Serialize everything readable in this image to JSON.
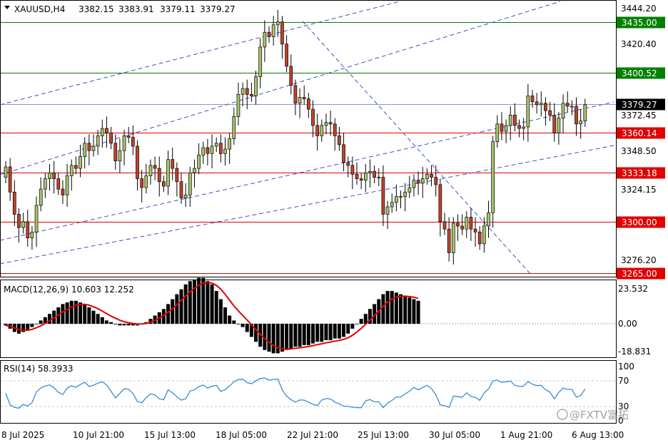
{
  "header": {
    "symbol": "XAUUSD,H4",
    "open": "3382.15",
    "high": "3383.91",
    "low": "3379.11",
    "close": "3379.27"
  },
  "price_axis": {
    "ticks": [
      "3444.20",
      "3420.40",
      "3372.45",
      "3348.50",
      "3324.15",
      "3276.20"
    ],
    "levels": [
      {
        "price": 3435.0,
        "label": "3435.00",
        "color": "#008000"
      },
      {
        "price": 3400.52,
        "label": "3400.52",
        "color": "#008000"
      },
      {
        "price": 3379.27,
        "label": "3379.27",
        "color": "#000000"
      },
      {
        "price": 3360.14,
        "label": "3360.14",
        "color": "#e00000"
      },
      {
        "price": 3333.18,
        "label": "3333.18",
        "color": "#e00000"
      },
      {
        "price": 3300.0,
        "label": "3300.00",
        "color": "#e00000"
      },
      {
        "price": 3265.0,
        "label": "3265.00",
        "color": "#e00000"
      }
    ]
  },
  "macd": {
    "label": "MACD(12,26,9) 10.603 12.252",
    "ticks": [
      "23.532",
      "0.00",
      "-18.831"
    ]
  },
  "rsi": {
    "label": "RSI(14) 58.3933",
    "ticks": [
      "100",
      "70",
      "30",
      "0"
    ]
  },
  "time_axis": {
    "labels": [
      "8 Jul 2025",
      "10 Jul 21:00",
      "15 Jul 13:00",
      "18 Jul 05:00",
      "22 Jul 21:00",
      "25 Jul 13:00",
      "30 Jul 05:00",
      "1 Aug 21:00",
      "6 Aug 13:00"
    ]
  },
  "watermark": {
    "text": "@FXTV富拓"
  },
  "colors": {
    "bull": "#a8c46a",
    "bear": "#c0432a",
    "support": "#e00000",
    "resistance": "#008000",
    "channel": "#2540c0",
    "signal": "#e00000",
    "rsi_line": "#3a8ad6"
  },
  "chart_data": {
    "type": "candlestick",
    "symbol": "XAUUSD",
    "timeframe": "H4",
    "close": [
      3337,
      3320,
      3305,
      3296,
      3300,
      3289,
      3293,
      3311,
      3322,
      3329,
      3333,
      3329,
      3322,
      3318,
      3331,
      3338,
      3336,
      3344,
      3353,
      3348,
      3351,
      3358,
      3363,
      3360,
      3353,
      3341,
      3348,
      3358,
      3357,
      3351,
      3329,
      3323,
      3331,
      3338,
      3336,
      3327,
      3324,
      3342,
      3336,
      3327,
      3316,
      3318,
      3333,
      3336,
      3345,
      3350,
      3346,
      3351,
      3353,
      3346,
      3349,
      3356,
      3371,
      3386,
      3390,
      3386,
      3385,
      3398,
      3418,
      3428,
      3425,
      3433,
      3435,
      3420,
      3405,
      3392,
      3380,
      3384,
      3383,
      3376,
      3365,
      3358,
      3365,
      3367,
      3366,
      3358,
      3352,
      3340,
      3338,
      3332,
      3329,
      3328,
      3333,
      3334,
      3330,
      3330,
      3305,
      3310,
      3313,
      3317,
      3317,
      3320,
      3323,
      3328,
      3326,
      3329,
      3332,
      3330,
      3325,
      3300,
      3295,
      3279,
      3299,
      3297,
      3295,
      3303,
      3295,
      3293,
      3285,
      3297,
      3306,
      3354,
      3366,
      3361,
      3365,
      3372,
      3365,
      3363,
      3364,
      3385,
      3381,
      3379,
      3380,
      3375,
      3372,
      3360,
      3370,
      3380,
      3378,
      3378,
      3366,
      3368,
      3379
    ],
    "macd_hist": [
      -1,
      -3,
      -5,
      -6,
      -5,
      -4,
      -2,
      0,
      2,
      4,
      6,
      8,
      10,
      12,
      13,
      14,
      14,
      13,
      12,
      10,
      8,
      6,
      4,
      2,
      1,
      0,
      -1,
      -1,
      -1,
      -1,
      -1,
      0,
      1,
      3,
      5,
      7,
      9,
      12,
      15,
      18,
      21,
      24,
      26,
      27,
      28,
      28,
      26,
      24,
      20,
      15,
      10,
      5,
      2,
      0,
      -2,
      -5,
      -8,
      -11,
      -14,
      -16,
      -17,
      -18,
      -18,
      -17,
      -16,
      -15,
      -14,
      -14,
      -13,
      -13,
      -12,
      -11,
      -11,
      -10,
      -10,
      -9,
      -9,
      -8,
      -6,
      -3,
      0,
      3,
      6,
      9,
      12,
      15,
      18,
      20,
      20,
      19,
      18,
      17,
      16,
      15,
      14
    ]
  }
}
